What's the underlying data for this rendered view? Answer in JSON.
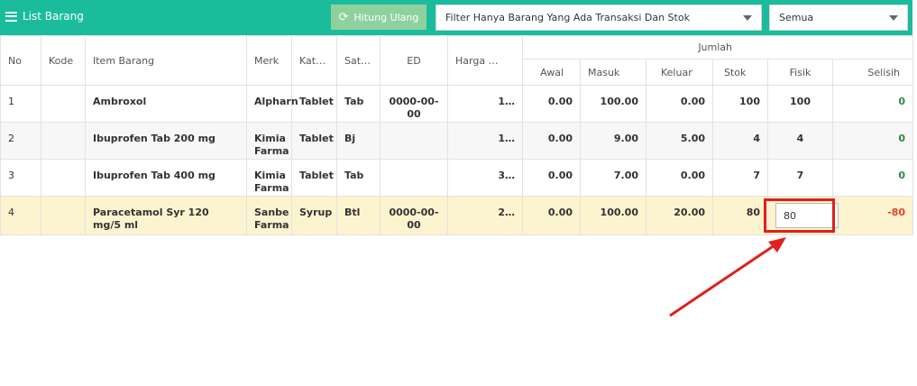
{
  "header": {
    "title": "List Barang",
    "recalc_label": "Hitung Ulang",
    "filter_value": "Filter Hanya Barang Yang Ada Transaksi Dan Stok",
    "status_value": "Semua"
  },
  "columns": {
    "no": "No",
    "kode": "Kode",
    "item": "Item Barang",
    "merk": "Merk",
    "kat": "Kat…",
    "sat": "Sat…",
    "ed": "ED",
    "harga": "Harga …",
    "jumlah": "Jumlah",
    "awal": "Awal",
    "masuk": "Masuk",
    "keluar": "Keluar",
    "stok": "Stok",
    "fisik": "Fisik",
    "selisih": "Selisih"
  },
  "rows": [
    {
      "no": "1",
      "kode": "",
      "item": "Ambroxol",
      "merk": "Alpharn",
      "kat": "Tablet",
      "sat": "Tab",
      "ed": "0000-00-00",
      "harga": "1…",
      "awal": "0.00",
      "masuk": "100.00",
      "keluar": "0.00",
      "stok": "100",
      "fisik": "100",
      "selisih": "0"
    },
    {
      "no": "2",
      "kode": "",
      "item": "Ibuprofen Tab 200 mg",
      "merk": "Kimia Farma",
      "kat": "Tablet",
      "sat": "Bj",
      "ed": "",
      "harga": "1…",
      "awal": "0.00",
      "masuk": "9.00",
      "keluar": "5.00",
      "stok": "4",
      "fisik": "4",
      "selisih": "0"
    },
    {
      "no": "3",
      "kode": "",
      "item": "Ibuprofen Tab 400 mg",
      "merk": "Kimia Farma",
      "kat": "Tablet",
      "sat": "Tab",
      "ed": "",
      "harga": "3…",
      "awal": "0.00",
      "masuk": "7.00",
      "keluar": "0.00",
      "stok": "7",
      "fisik": "7",
      "selisih": "0"
    },
    {
      "no": "4",
      "kode": "",
      "item": "Paracetamol Syr 120 mg/5 ml",
      "merk": "Sanbe Farma",
      "kat": "Syrup",
      "sat": "Btl",
      "ed": "0000-00-00",
      "harga": "2…",
      "awal": "0.00",
      "masuk": "100.00",
      "keluar": "20.00",
      "stok": "80",
      "fisik": "80",
      "selisih": "-80"
    }
  ],
  "colors": {
    "accent": "#1abc9c",
    "highlight": "#fcf3cf",
    "annotation": "#e0201c",
    "positive": "#2e8b3d",
    "negative": "#e0432b"
  },
  "icons": {
    "list": "list-icon",
    "refresh": "refresh-icon",
    "dropdown": "chevron-down-icon"
  }
}
